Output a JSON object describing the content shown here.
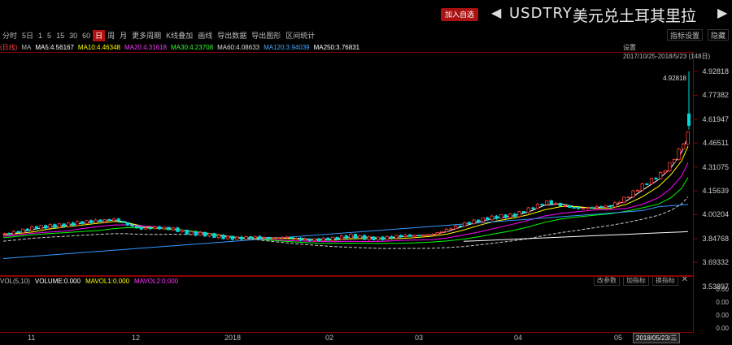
{
  "header": {
    "add_favorite": "加入自选",
    "symbol": "USDTRY",
    "symbol_cn": "美元兑土耳其里拉",
    "prev_arrow": "◀",
    "next_arrow": "▶"
  },
  "toolbar": {
    "items": [
      "分时",
      "5日",
      "1",
      "5",
      "15",
      "30",
      "60",
      "日",
      "周",
      "月",
      "更多周期",
      "K线叠加",
      "画线",
      "导出数据",
      "导出图形",
      "区间统计"
    ],
    "active_index": 7,
    "right_items": [
      "指标设置",
      "隐藏"
    ]
  },
  "ma_line": {
    "period": "(日线)",
    "label": "MA",
    "ma5": "MA5:4.56167",
    "ma10": "MA10:4.46348",
    "ma20": "MA20:4.31618",
    "ma30": "MA30:4.23708",
    "ma60": "MA60:4.08633",
    "ma120": "MA120:3.94039",
    "ma250": "MA250:3.76831"
  },
  "range_info": {
    "settings": "设置",
    "range": "2017/10/25-2018/5/23 (148日)"
  },
  "yaxis": {
    "labels": [
      "4.92818",
      "4.77382",
      "4.61947",
      "4.46511",
      "4.31075",
      "4.15639",
      "4.00204",
      "3.84768",
      "3.69332",
      "3.53897"
    ],
    "current_price": "4.92818"
  },
  "volume": {
    "params": "VOL(5,10)",
    "volume": "VOLUME:0.000",
    "mavol1": "MAVOL1:0.000",
    "mavol2": "MAVOL2:0.000",
    "buttons": [
      "改参数",
      "加指标",
      "换指标"
    ],
    "close": "✕",
    "axis": [
      "0.00",
      "0.00",
      "0.00",
      "0.00"
    ]
  },
  "xaxis": {
    "labels": [
      "11",
      "12",
      "2018",
      "02",
      "03",
      "04",
      "05"
    ],
    "cursor_date": "2018/05/23/三"
  },
  "chart_data": {
    "type": "candlestick",
    "ylim": [
      3.53897,
      4.98
    ],
    "colors": {
      "up": "#ff3b3b",
      "down": "#00d8d8",
      "ma5": "#ffffff",
      "ma10": "#ffff00",
      "ma20": "#ff00ff",
      "ma30": "#00ff00",
      "ma60": "#cccccc",
      "ma120": "#3399ff",
      "ma250": "#ffffff"
    }
  }
}
